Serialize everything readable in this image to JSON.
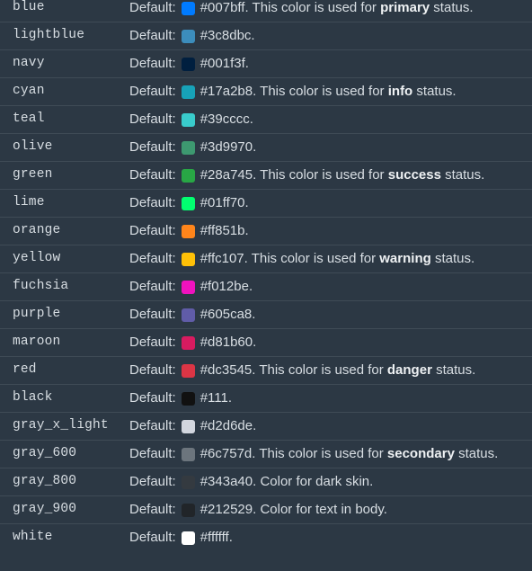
{
  "default_label": "Default:",
  "status_prefix": ". This color is used for ",
  "status_suffix": " status.",
  "colors": [
    {
      "name": "blue",
      "hex": "#007bff",
      "swatch": "#007bff",
      "status": "primary"
    },
    {
      "name": "lightblue",
      "hex": "#3c8dbc",
      "swatch": "#3c8dbc"
    },
    {
      "name": "navy",
      "hex": "#001f3f",
      "swatch": "#001f3f"
    },
    {
      "name": "cyan",
      "hex": "#17a2b8",
      "swatch": "#17a2b8",
      "status": "info"
    },
    {
      "name": "teal",
      "hex": "#39cccc",
      "swatch": "#39cccc"
    },
    {
      "name": "olive",
      "hex": "#3d9970",
      "swatch": "#3d9970"
    },
    {
      "name": "green",
      "hex": "#28a745",
      "swatch": "#28a745",
      "status": "success"
    },
    {
      "name": "lime",
      "hex": "#01ff70",
      "swatch": "#01ff70"
    },
    {
      "name": "orange",
      "hex": "#ff851b",
      "swatch": "#ff851b"
    },
    {
      "name": "yellow",
      "hex": "#ffc107",
      "swatch": "#ffc107",
      "status": "warning"
    },
    {
      "name": "fuchsia",
      "hex": "#f012be",
      "swatch": "#f012be"
    },
    {
      "name": "purple",
      "hex": "#605ca8",
      "swatch": "#605ca8"
    },
    {
      "name": "maroon",
      "hex": "#d81b60",
      "swatch": "#d81b60"
    },
    {
      "name": "red",
      "hex": "#dc3545",
      "swatch": "#dc3545",
      "status": "danger"
    },
    {
      "name": "black",
      "hex": "#111",
      "swatch": "#111111"
    },
    {
      "name": "gray_x_light",
      "hex": "#d2d6de",
      "swatch": "#d2d6de"
    },
    {
      "name": "gray_600",
      "hex": "#6c757d",
      "swatch": "#6c757d",
      "status": "secondary"
    },
    {
      "name": "gray_800",
      "hex": "#343a40",
      "swatch": "#343a40",
      "note": "Color for dark skin."
    },
    {
      "name": "gray_900",
      "hex": "#212529",
      "swatch": "#212529",
      "note": "Color for text in body."
    },
    {
      "name": "white",
      "hex": "#ffffff",
      "swatch": "#ffffff"
    }
  ]
}
